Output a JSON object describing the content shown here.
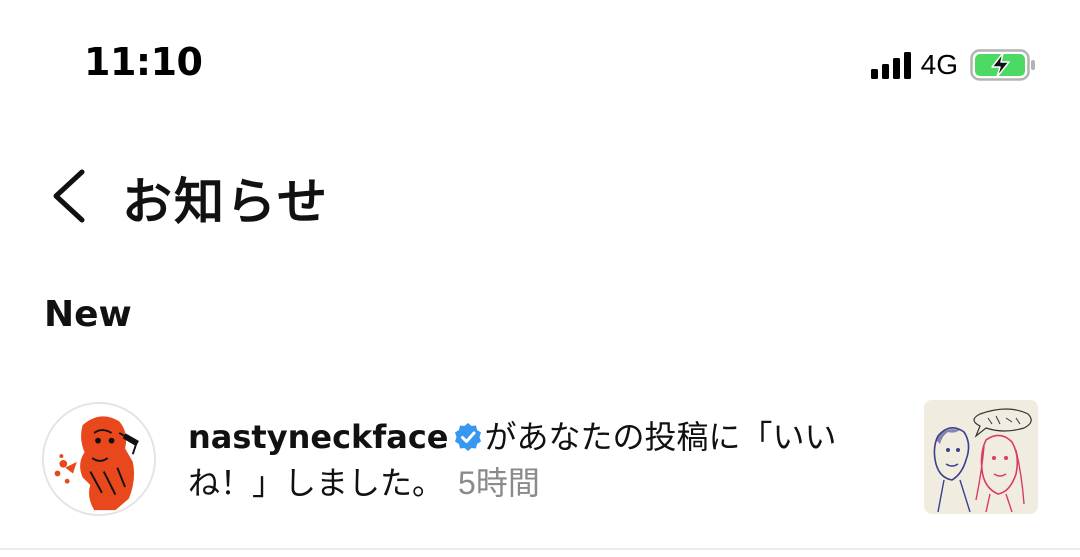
{
  "status_bar": {
    "time": "11:10",
    "network": "4G",
    "icons": [
      "signal-icon",
      "battery-charging-icon"
    ],
    "battery_color": "#4cd964"
  },
  "header": {
    "back_icon": "chevron-left-icon",
    "title": "お知らせ"
  },
  "section": {
    "title": "New"
  },
  "notifications": [
    {
      "username": "nastyneckface",
      "verified": true,
      "message": "があなたの投稿に「いいね！」しました。",
      "time": "5時間",
      "avatar_icon": "avatar-illustration",
      "thumb_icon": "post-thumbnail-sketch"
    }
  ],
  "colors": {
    "verified_blue": "#3897f0",
    "timestamp_gray": "#8a8a8a",
    "avatar_red": "#e8481b"
  }
}
